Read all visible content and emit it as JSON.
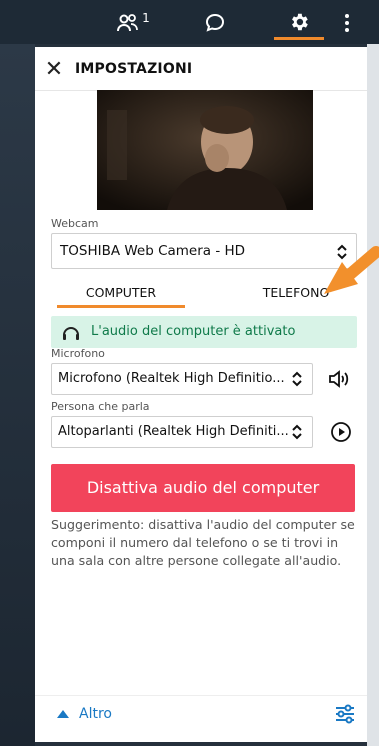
{
  "topbar": {
    "participants_count": "1"
  },
  "panel": {
    "title": "IMPOSTAZIONI",
    "webcam_label": "Webcam",
    "webcam_value": "TOSHIBA Web Camera - HD",
    "tabs": [
      {
        "label": "COMPUTER",
        "active": true
      },
      {
        "label": "TELEFONO",
        "active": false
      }
    ],
    "notice": "L'audio del computer è attivato",
    "mic_label": "Microfono",
    "mic_value": "Microfono (Realtek High Definitio...",
    "speaker_label": "Persona che parla",
    "speaker_value": "Altoparlanti (Realtek High Definiti...",
    "mute_button": "Disattiva audio del computer",
    "hint": "Suggerimento: disattiva l'audio del computer se componi il numero dal telefono o se ti trovi in una sala con altre persone collegate all'audio.",
    "more_label": "Altro"
  },
  "colors": {
    "accent": "#f08a2c",
    "danger": "#f2445b",
    "success_bg": "#d8f3e7",
    "link": "#1a79c4"
  }
}
